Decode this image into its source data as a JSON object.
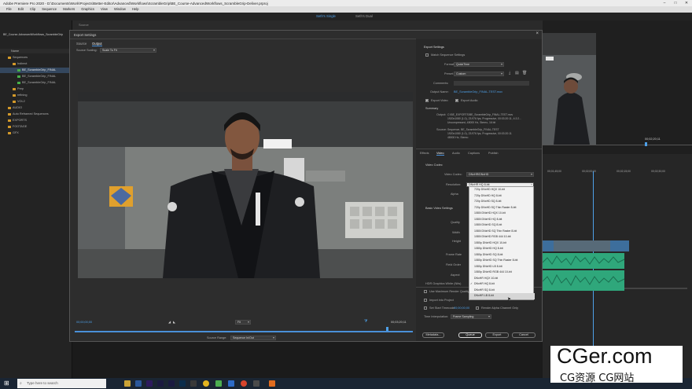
{
  "window": {
    "title": "Adobe Premiere Pro 2020 - D:\\Documents\\Work\\Projects\\Better-Editor\\Advanced\\Workflows\\ScrambleGrip\\BE_Course-AdvancedWorkflows_ScrambleGrip-Deliver.prproj"
  },
  "menu": [
    "File",
    "Edit",
    "Clip",
    "Sequence",
    "Markers",
    "Graphics",
    "View",
    "Window",
    "Help"
  ],
  "workspaces": [
    {
      "label": "Seth's Single",
      "active": true
    },
    {
      "label": "Seth's Dual",
      "active": false
    }
  ],
  "project": {
    "title": "BE_Course-AdvancedWorkflows_ScrambleGrip",
    "column_name": "Name",
    "items": [
      {
        "label": "Sequences",
        "kind": "folder",
        "depth": 1
      },
      {
        "label": "Indirect",
        "kind": "folder",
        "depth": 2
      },
      {
        "label": "BE_ScrambleGrip_FINAL",
        "kind": "sequence",
        "depth": 3,
        "selected": true
      },
      {
        "label": "BE_ScrambleGrip_FINAL",
        "kind": "sequence",
        "depth": 3
      },
      {
        "label": "BE_ScrambleGrip_FINAL",
        "kind": "sequence",
        "depth": 3
      },
      {
        "label": "Prep",
        "kind": "folder",
        "depth": 2
      },
      {
        "label": "refining",
        "kind": "folder",
        "depth": 2
      },
      {
        "label": "VOL2",
        "kind": "folder",
        "depth": 2
      },
      {
        "label": "AUDIO",
        "kind": "folder",
        "depth": 1
      },
      {
        "label": "Auto Reframed Sequences",
        "kind": "folder",
        "depth": 1
      },
      {
        "label": "EXPORTS",
        "kind": "folder",
        "depth": 1
      },
      {
        "label": "FOOTAGE",
        "kind": "folder",
        "depth": 1
      },
      {
        "label": "GFX",
        "kind": "folder",
        "depth": 1
      }
    ]
  },
  "export_dialog": {
    "title": "Export Settings",
    "tabs": [
      {
        "label": "Source",
        "active": false
      },
      {
        "label": "Output",
        "active": true
      }
    ],
    "source_scaling_label": "Source Scaling:",
    "source_scaling_value": "Scale To Fit",
    "timecode_in": "00;00;00;00",
    "timecode_out": "00;03;20;11",
    "fit_value": "Fit",
    "source_range_label": "Source Range:",
    "source_range_value": "Sequence In/Out",
    "export_settings": {
      "heading": "Export Settings",
      "match_sequence": "Match Sequence Settings",
      "format_label": "Format:",
      "format_value": "QuickTime",
      "preset_label": "Preset:",
      "preset_value": "Custom",
      "comments_label": "Comments:",
      "output_name_label": "Output Name:",
      "output_name_value": "BE_ScrambleGrip_FINAL-TEST.mov",
      "export_video": "Export Video",
      "export_audio": "Export Audio"
    },
    "summary": {
      "heading": "Summary",
      "output_label": "Output:",
      "output_lines": [
        "C:\\BE_EXPORTS\\BE_ScrambleGrip_FINAL-TEST.mov",
        "1920x1080 (1.0), 23.976 fps, Progressive, 00:03:20:11, 4:2:2...",
        "Uncompressed, 48000 Hz, Stereo, 16 bit"
      ],
      "source_label": "Source:",
      "source_lines": [
        "Sequence, BE_ScrambleGrip_FINAL-TEST",
        "1920x1080 (1.0), 23.976 fps, Progressive, 00:03:20:11",
        "48000 Hz, Stereo"
      ]
    },
    "setting_tabs": [
      {
        "label": "Effects",
        "active": false
      },
      {
        "label": "Video",
        "active": true
      },
      {
        "label": "Audio",
        "active": false
      },
      {
        "label": "Captions",
        "active": false
      },
      {
        "label": "Publish",
        "active": false
      }
    ],
    "video_codec": {
      "heading": "Video Codec",
      "codec_label": "Video Codec:",
      "codec_value": "DNxHR/DNxHD",
      "resolution_label": "Resolution:",
      "resolution_value": "DNxHR HQ 8-bit",
      "alpha_label": "Alpha"
    },
    "basic_video": {
      "heading": "Basic Video Settings",
      "labels": [
        "Quality",
        "Width",
        "Height",
        "Frame Rate",
        "Field Order",
        "Aspect",
        "HDR Graphics White (Nits)"
      ]
    },
    "resolution_options": [
      "720p DNxHD HQX 10-bit",
      "720p DNxHD HQ 8-bit",
      "720p DNxHD SQ 8-bit",
      "720p DNxHD SQ Thin Raster 8-bit",
      "1080i DNxHD HQX 10-bit",
      "1080i DNxHD HQ 8-bit",
      "1080i DNxHD SQ 8-bit",
      "1080i DNxHD SQ Thin Raster 8-bit",
      "1080i DNxHD RGB 444 10-bit",
      "1080p DNxHD HQX 10-bit",
      "1080p DNxHD HQ 8-bit",
      "1080p DNxHD SQ 8-bit",
      "1080p DNxHD SQ Thin Raster 8-bit",
      "1080p DNxHD LB 8-bit",
      "1080p DNxHD RGB 444 10-bit",
      "DNxHR HQX 10-bit",
      "DNxHR HQ 8-bit",
      "DNxHR SQ 8-bit",
      "DNxHR LB 8-bit"
    ],
    "resolution_current_index": 16,
    "resolution_hover_index": 18,
    "bottom_options": {
      "max_render_quality": "Use Maximum Render Quality",
      "import_into_project": "Import into Project",
      "set_start_timecode": "Set Start Timecode",
      "start_timecode_value": "00;00;00;00",
      "render_alpha": "Render Alpha Channel Only",
      "time_interp_label": "Time Interpolation:",
      "time_interp_value": "Frame Sampling"
    },
    "buttons": {
      "metadata": "Metadata...",
      "queue": "Queue",
      "export": "Export",
      "cancel": "Cancel"
    }
  },
  "timeline": {
    "timecode": "00;02;20;11",
    "ruler": [
      "00;01;45;00",
      "00;02;00;00",
      "00;02;15;00",
      "00;02;30;00"
    ]
  },
  "taskbar": {
    "search_placeholder": "Type here to search"
  },
  "watermark": {
    "brand": "CGer.com",
    "sub": "CG资源 CG网站"
  },
  "colors": {
    "accent": "#4ea0e8",
    "folder": "#d49a2a",
    "sequence": "#48b04a",
    "audio_clip": "#2fa77b"
  }
}
